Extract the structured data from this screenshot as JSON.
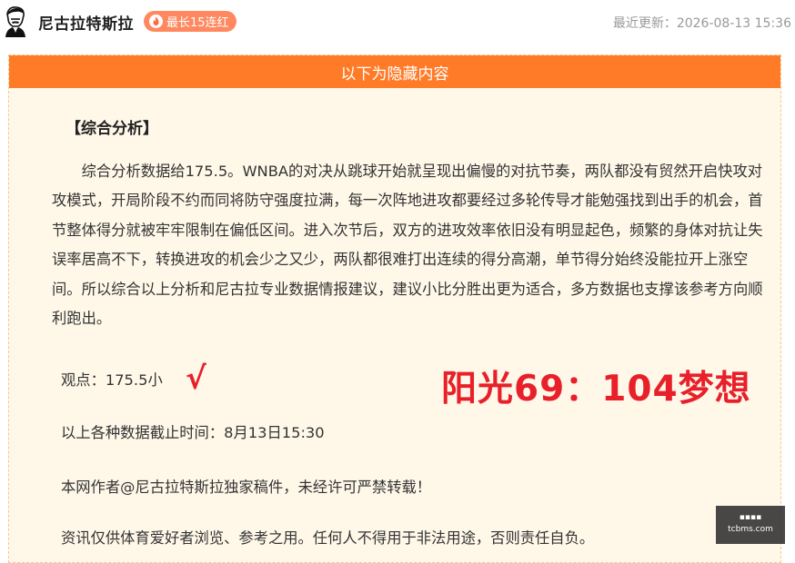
{
  "header": {
    "author_name": "尼古拉特斯拉",
    "streak_badge": "最长15连红",
    "last_updated": "最近更新：2026-08-13 15:36"
  },
  "panel": {
    "hidden_banner": "以下为隐藏内容",
    "section_title": "【综合分析】",
    "analysis_text": "综合分析数据给175.5。WNBA的对决从跳球开始就呈现出偏慢的对抗节奏，两队都没有贸然开启快攻对攻模式，开局阶段不约而同将防守强度拉满，每一次阵地进攻都要经过多轮传导才能勉强找到出手的机会，首节整体得分就被牢牢限制在偏低区间。进入次节后，双方的进攻效率依旧没有明显起色，频繁的身体对抗让失误率居高不下，转换进攻的机会少之又少，两队都很难打出连续的得分高潮，单节得分始终没能拉开上涨空间。所以综合以上分析和尼古拉专业数据情报建议，建议小比分胜出更为适合，多方数据也支撑该参考方向顺利跑出。",
    "viewpoint": "观点：175.5小",
    "checkmark": "√",
    "final_score": "阳光69：104梦想",
    "data_cutoff": "以上各种数据截止时间：8月13日15:30",
    "copyright_notice": "本网作者@尼古拉特斯拉独家稿件，未经许可严禁转载！",
    "disclaimer": "资讯仅供体育爱好者浏览、参考之用。任何人不得用于非法用途，否则责任自负。"
  },
  "watermark": {
    "line1": "▪▪▪▪",
    "line2": "tcbms.com"
  },
  "colors": {
    "banner": "#ff7b28",
    "panel_bg": "#fff8e9",
    "highlight_red": "#e8202a",
    "badge": "#ff8860"
  }
}
